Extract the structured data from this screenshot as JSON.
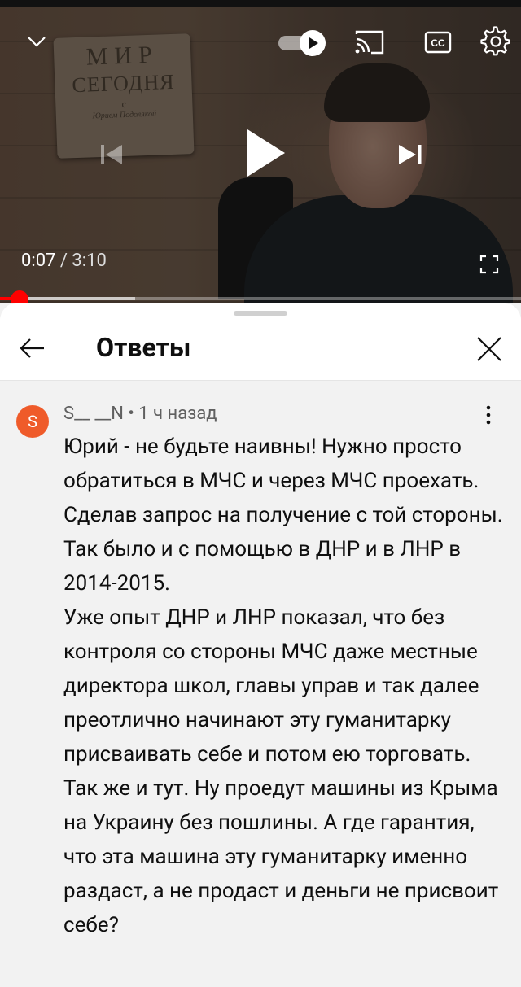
{
  "player": {
    "sign_lines": [
      "МИР",
      "СЕГОДНЯ",
      "с",
      "Юрием Подолякой"
    ],
    "time_current": "0:07",
    "time_separator": " / ",
    "time_total": "3:10",
    "progress_fraction": 0.037,
    "buffered_fraction": 0.26,
    "icons": {
      "collapse": "chevron-down-icon",
      "autoplay": "autoplay-toggle-icon",
      "cast": "cast-icon",
      "captions": "cc-icon",
      "settings": "gear-icon",
      "previous": "skip-previous-icon",
      "play": "play-icon",
      "next": "skip-next-icon",
      "fullscreen": "fullscreen-icon"
    },
    "cc_label": "CC",
    "accent_color": "#ff0000"
  },
  "sheet": {
    "title": "Ответы",
    "back_icon": "arrow-left-icon",
    "close_icon": "close-icon"
  },
  "comment": {
    "avatar_letter": "S",
    "avatar_color": "#ef5b2a",
    "author": "S__ __N",
    "dot": " • ",
    "time": "1 ч назад",
    "more_icon": "more-vert-icon",
    "paragraphs": [
      "Юрий - не будьте наивны! Нужно просто обратиться в МЧС и через МЧС проехать. Сделав запрос на получение с той стороны. Так было и с помощью в ДНР и в ЛНР в 2014-2015.",
      "Уже опыт ДНР и ЛНР показал, что без контроля со стороны МЧС даже местные директора школ, главы управ и так далее преотлично начинают эту гуманитарку присваивать себе и потом ею торговать.",
      "Так же и тут. Ну проедут машины из Крыма на Украину без пошлины. А где гарантия, что эта машина эту гуманитарку именно раздаст, а не продаст и деньги не присвоит себе?"
    ]
  }
}
